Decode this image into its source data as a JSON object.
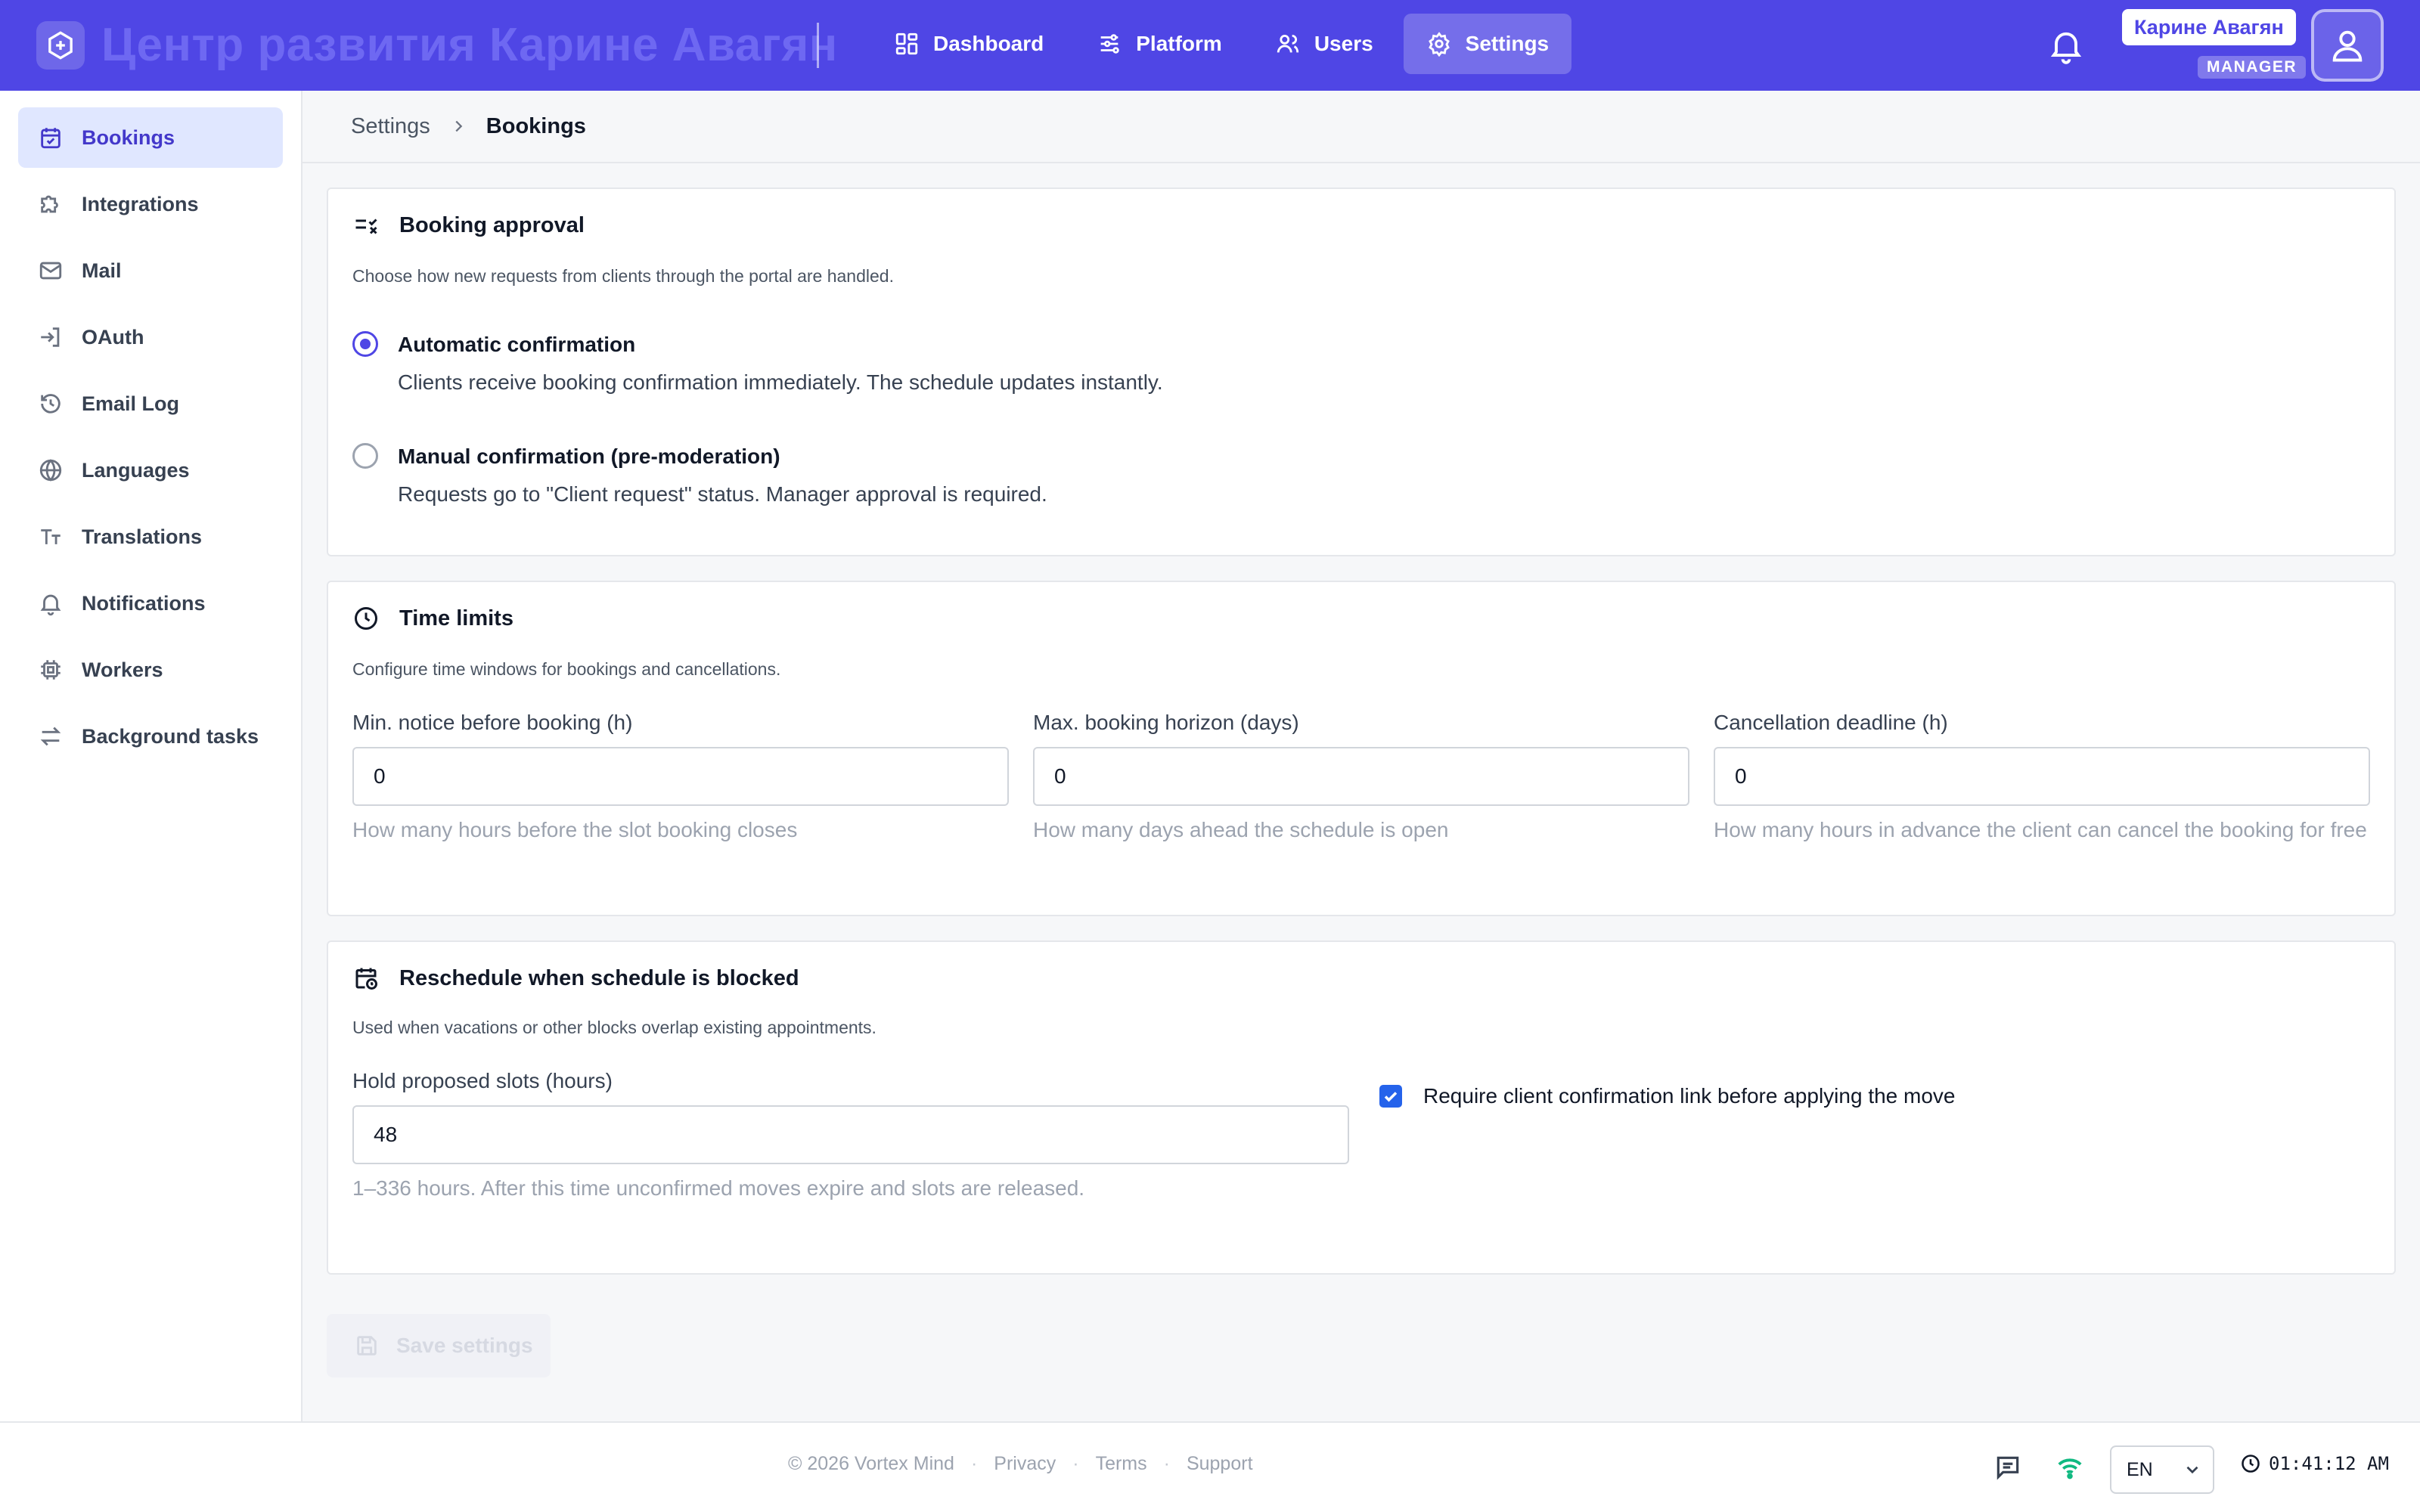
{
  "app": {
    "title": "Центр развития Карине Авагян",
    "brand_color": "#4f46e5"
  },
  "topnav": {
    "items": [
      {
        "label": "Dashboard",
        "icon": "grid-icon"
      },
      {
        "label": "Platform",
        "icon": "sliders-icon"
      },
      {
        "label": "Users",
        "icon": "users-icon"
      },
      {
        "label": "Settings",
        "icon": "gear-icon",
        "active": true
      }
    ]
  },
  "user": {
    "name": "Карине Авагян",
    "role": "MANAGER"
  },
  "sidebar": {
    "items": [
      {
        "label": "Bookings",
        "icon": "calendar-check-icon",
        "active": true
      },
      {
        "label": "Integrations",
        "icon": "puzzle-icon"
      },
      {
        "label": "Mail",
        "icon": "mail-icon"
      },
      {
        "label": "OAuth",
        "icon": "login-icon"
      },
      {
        "label": "Email Log",
        "icon": "history-icon"
      },
      {
        "label": "Languages",
        "icon": "globe-icon"
      },
      {
        "label": "Translations",
        "icon": "text-size-icon"
      },
      {
        "label": "Notifications",
        "icon": "bell-icon"
      },
      {
        "label": "Workers",
        "icon": "cpu-icon"
      },
      {
        "label": "Background tasks",
        "icon": "arrows-exchange-icon"
      }
    ]
  },
  "breadcrumb": {
    "parent": "Settings",
    "current": "Bookings"
  },
  "booking_approval": {
    "title": "Booking approval",
    "description": "Choose how new requests from clients through the portal are handled.",
    "options": [
      {
        "label": "Automatic confirmation",
        "description": "Clients receive booking confirmation immediately. The schedule updates instantly.",
        "selected": true
      },
      {
        "label": "Manual confirmation (pre-moderation)",
        "description": "Requests go to \"Client request\" status. Manager approval is required.",
        "selected": false
      }
    ]
  },
  "time_limits": {
    "title": "Time limits",
    "description": "Configure time windows for bookings and cancellations.",
    "fields": [
      {
        "label": "Min. notice before booking (h)",
        "value": "0",
        "help": "How many hours before the slot booking closes"
      },
      {
        "label": "Max. booking horizon (days)",
        "value": "0",
        "help": "How many days ahead the schedule is open"
      },
      {
        "label": "Cancellation deadline (h)",
        "value": "0",
        "help": "How many hours in advance the client can cancel the booking for free"
      }
    ]
  },
  "reschedule": {
    "title": "Reschedule when schedule is blocked",
    "description": "Used when vacations or other blocks overlap existing appointments.",
    "hold_label": "Hold proposed slots (hours)",
    "hold_value": "48",
    "hold_help": "1–336 hours. After this time unconfirmed moves expire and slots are released.",
    "require_link_label": "Require client confirmation link before applying the move",
    "require_link_checked": true
  },
  "save_button": {
    "label": "Save settings",
    "enabled": false
  },
  "footer": {
    "copyright": "© 2026 Vortex Mind",
    "links": [
      "Privacy",
      "Terms",
      "Support"
    ],
    "language": "EN",
    "time": "01:41:12 AM",
    "connection_color": "#10b981"
  }
}
